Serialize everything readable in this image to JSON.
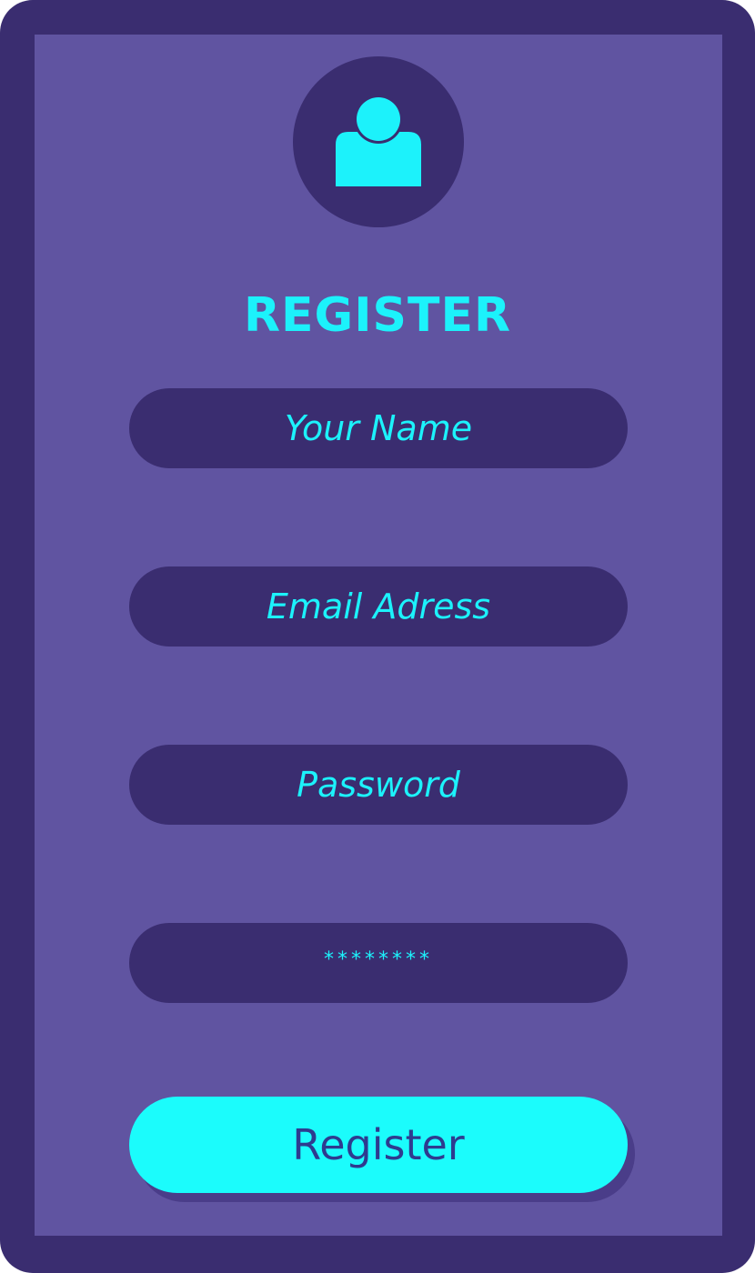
{
  "form": {
    "title": "REGISTER",
    "avatar_icon": "user-icon",
    "fields": {
      "name_placeholder": "Your Name",
      "email_placeholder": "Email Adress",
      "password_placeholder": "Password",
      "confirm_value": "********"
    },
    "submit_label": "Register"
  },
  "colors": {
    "frame": "#3a2d70",
    "panel": "#6054a1",
    "accent": "#1cf2fb",
    "button_text": "#2e3b8f"
  }
}
